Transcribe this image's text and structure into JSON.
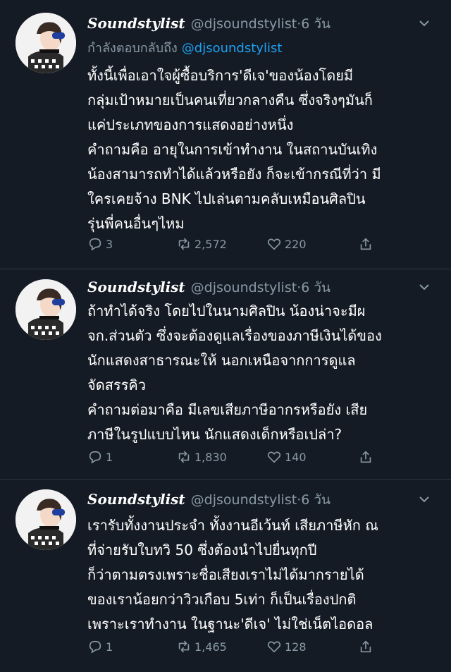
{
  "tweets": [
    {
      "display_name": "Soundstylist",
      "handle": "@djsoundstylist",
      "dot": "·",
      "time": "6 วัน",
      "reply_label": "กำลังตอบกลับถึง",
      "reply_mention": "@djsoundstylist",
      "lines": [
        "ทั้งนี้เพื่อเอาใจผู้ซื้อบริการ'ดีเจ'ของน้องโดยมี",
        "กลุ่มเป้าหมายเป็นคนเที่ยวกลางคืน ซึ่งจริงๆมันก็",
        "แค่ประเภทของการแสดงอย่างหนึ่ง",
        "คำถามคือ อายุในการเข้าทำงาน ในสถานบันเทิง",
        "น้องสามารถทำได้แล้วหรือยัง ก็จะเข้ากรณีที่ว่า มี",
        "ใครเคยจ้าง BNK ไปเล่นตามคลับเหมือนศิลปิน",
        "รุ่นพี่คนอื่นๆไหม"
      ],
      "replies": "3",
      "retweets": "2,572",
      "likes": "220"
    },
    {
      "display_name": "Soundstylist",
      "handle": "@djsoundstylist",
      "dot": "·",
      "time": "6 วัน",
      "lines": [
        "ถ้าทำได้จริง โดยไปในนามศิลปิน น้องน่าจะมีผ",
        "จก.ส่วนตัว ซึ่งจะต้องดูแลเรื่องของภาษีเงินได้ของ",
        "นักแสดงสาธารณะให้ นอกเหนือจากการดูแล",
        "จัดสรรคิว",
        "คำถามต่อมาคือ มีเลขเสียภาษีอากรหรือยัง เสีย",
        "ภาษีในรูปแบบไหน นักแสดงเด็กหรือเปล่า?"
      ],
      "replies": "1",
      "retweets": "1,830",
      "likes": "140"
    },
    {
      "display_name": "Soundstylist",
      "handle": "@djsoundstylist",
      "dot": "·",
      "time": "6 วัน",
      "lines": [
        "เรารับทั้งงานประจำ ทั้งงานอีเว้นท์ เสียภาษีหัก ณ",
        "ที่จ่ายรับใบทวิ 50 ซึ่งต้องนำไปยื่นทุกปี",
        "ก็ว่าตามตรงเพราะชื่อเสียงเราไม่ได้มากรายได้",
        "ของเราน้อยกว่าวิวเกือบ 5เท่า ก็เป็นเรื่องปกติ",
        "เพราะเราทำงาน ในฐานะ'ดีเจ' ไม่ใช่เน็ตไอดอล"
      ],
      "replies": "1",
      "retweets": "1,465",
      "likes": "128"
    }
  ],
  "colors": {
    "background": "#151b24",
    "secondary_text": "#8899a6",
    "mention": "#1da1f2"
  }
}
